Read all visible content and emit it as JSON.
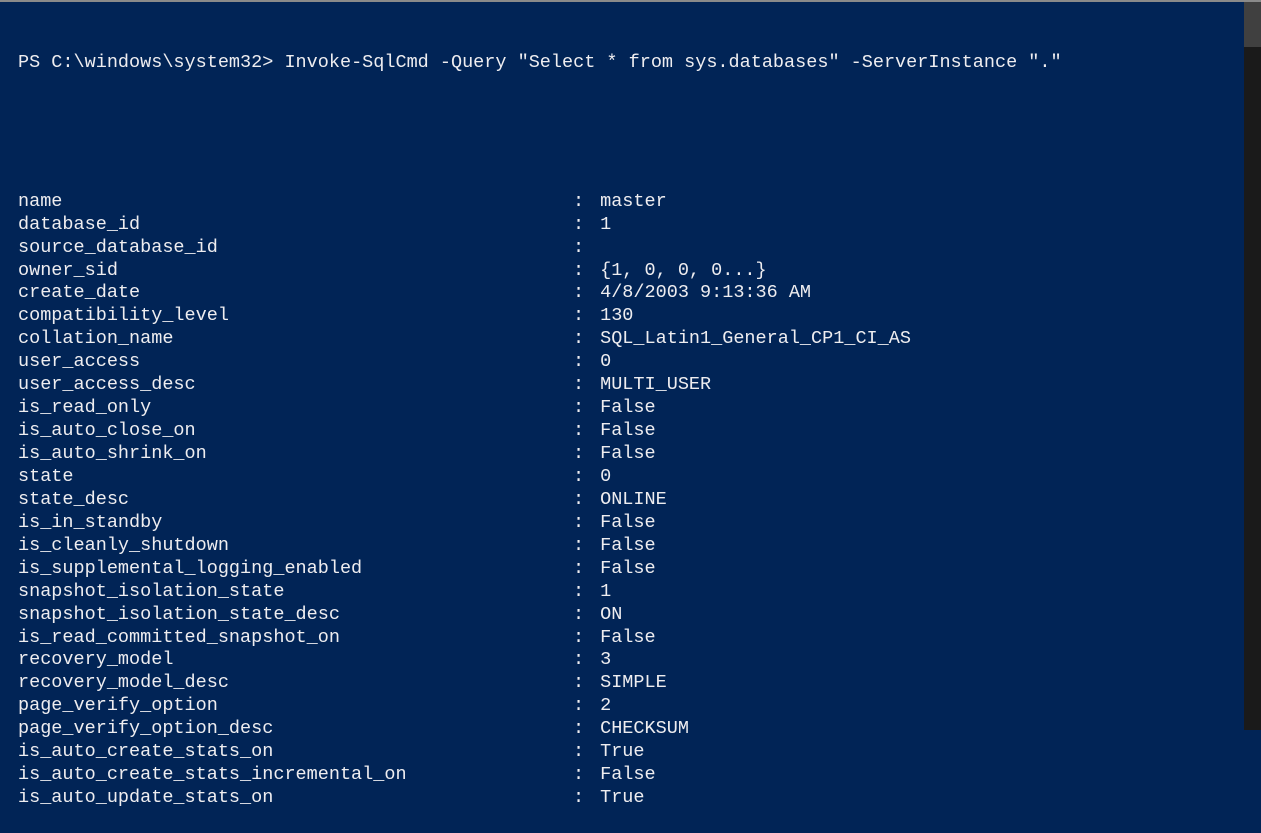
{
  "prompt": "PS C:\\windows\\system32>",
  "command": "Invoke-SqlCmd -Query \"Select * from sys.databases\" -ServerInstance \".\"",
  "fields": [
    {
      "name": "name",
      "value": "master"
    },
    {
      "name": "database_id",
      "value": "1"
    },
    {
      "name": "source_database_id",
      "value": ""
    },
    {
      "name": "owner_sid",
      "value": "{1, 0, 0, 0...}"
    },
    {
      "name": "create_date",
      "value": "4/8/2003 9:13:36 AM"
    },
    {
      "name": "compatibility_level",
      "value": "130"
    },
    {
      "name": "collation_name",
      "value": "SQL_Latin1_General_CP1_CI_AS"
    },
    {
      "name": "user_access",
      "value": "0"
    },
    {
      "name": "user_access_desc",
      "value": "MULTI_USER"
    },
    {
      "name": "is_read_only",
      "value": "False"
    },
    {
      "name": "is_auto_close_on",
      "value": "False"
    },
    {
      "name": "is_auto_shrink_on",
      "value": "False"
    },
    {
      "name": "state",
      "value": "0"
    },
    {
      "name": "state_desc",
      "value": "ONLINE"
    },
    {
      "name": "is_in_standby",
      "value": "False"
    },
    {
      "name": "is_cleanly_shutdown",
      "value": "False"
    },
    {
      "name": "is_supplemental_logging_enabled",
      "value": "False"
    },
    {
      "name": "snapshot_isolation_state",
      "value": "1"
    },
    {
      "name": "snapshot_isolation_state_desc",
      "value": "ON"
    },
    {
      "name": "is_read_committed_snapshot_on",
      "value": "False"
    },
    {
      "name": "recovery_model",
      "value": "3"
    },
    {
      "name": "recovery_model_desc",
      "value": "SIMPLE"
    },
    {
      "name": "page_verify_option",
      "value": "2"
    },
    {
      "name": "page_verify_option_desc",
      "value": "CHECKSUM"
    },
    {
      "name": "is_auto_create_stats_on",
      "value": "True"
    },
    {
      "name": "is_auto_create_stats_incremental_on",
      "value": "False"
    },
    {
      "name": "is_auto_update_stats_on",
      "value": "True"
    }
  ]
}
